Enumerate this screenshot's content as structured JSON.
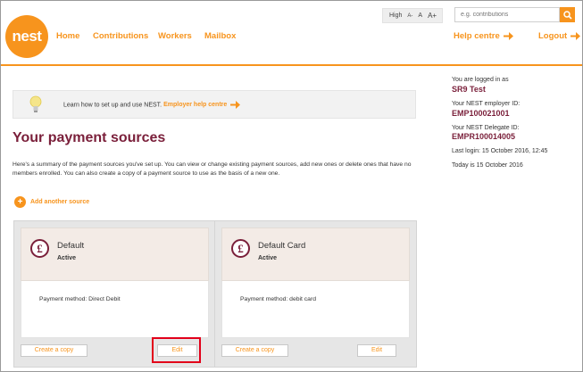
{
  "logo": {
    "text": "nest"
  },
  "nav": {
    "home": "Home",
    "contributions": "Contributions",
    "workers": "Workers",
    "mailbox": "Mailbox",
    "help_centre": "Help centre",
    "logout": "Logout"
  },
  "text_size": {
    "label": "High",
    "small": "A-",
    "normal": "A",
    "large": "A+"
  },
  "search": {
    "placeholder": "e.g. contributions"
  },
  "info_bar": {
    "text": "Learn how to set up and use NEST.",
    "link": "Employer help centre"
  },
  "page": {
    "title": "Your payment sources",
    "summary": "Here's a summary of the payment sources you've set up. You can view or change existing payment sources, add new ones or delete ones that have no members enrolled. You can also create a copy of a payment source to use as the basis of a new one.",
    "add_source": "Add another source"
  },
  "cards": [
    {
      "name": "Default",
      "status": "Active",
      "method": "Payment method: Direct Debit",
      "copy_label": "Create a copy",
      "edit_label": "Edit"
    },
    {
      "name": "Default Card",
      "status": "Active",
      "method": "Payment method: debit card",
      "copy_label": "Create a copy",
      "edit_label": "Edit"
    }
  ],
  "sidebar": {
    "logged_in_label": "You are logged in as",
    "user": "SR9 Test",
    "employer_id_label": "Your NEST employer ID:",
    "employer_id": "EMP100021001",
    "delegate_id_label": "Your NEST Delegate ID:",
    "delegate_id": "EMPR100014005",
    "last_login": "Last login: 15 October 2016, 12:45",
    "today": "Today is 15 October 2016"
  },
  "colors": {
    "brand": "#f7941d",
    "title": "#7a1f3a",
    "highlight": "#e2001a"
  }
}
